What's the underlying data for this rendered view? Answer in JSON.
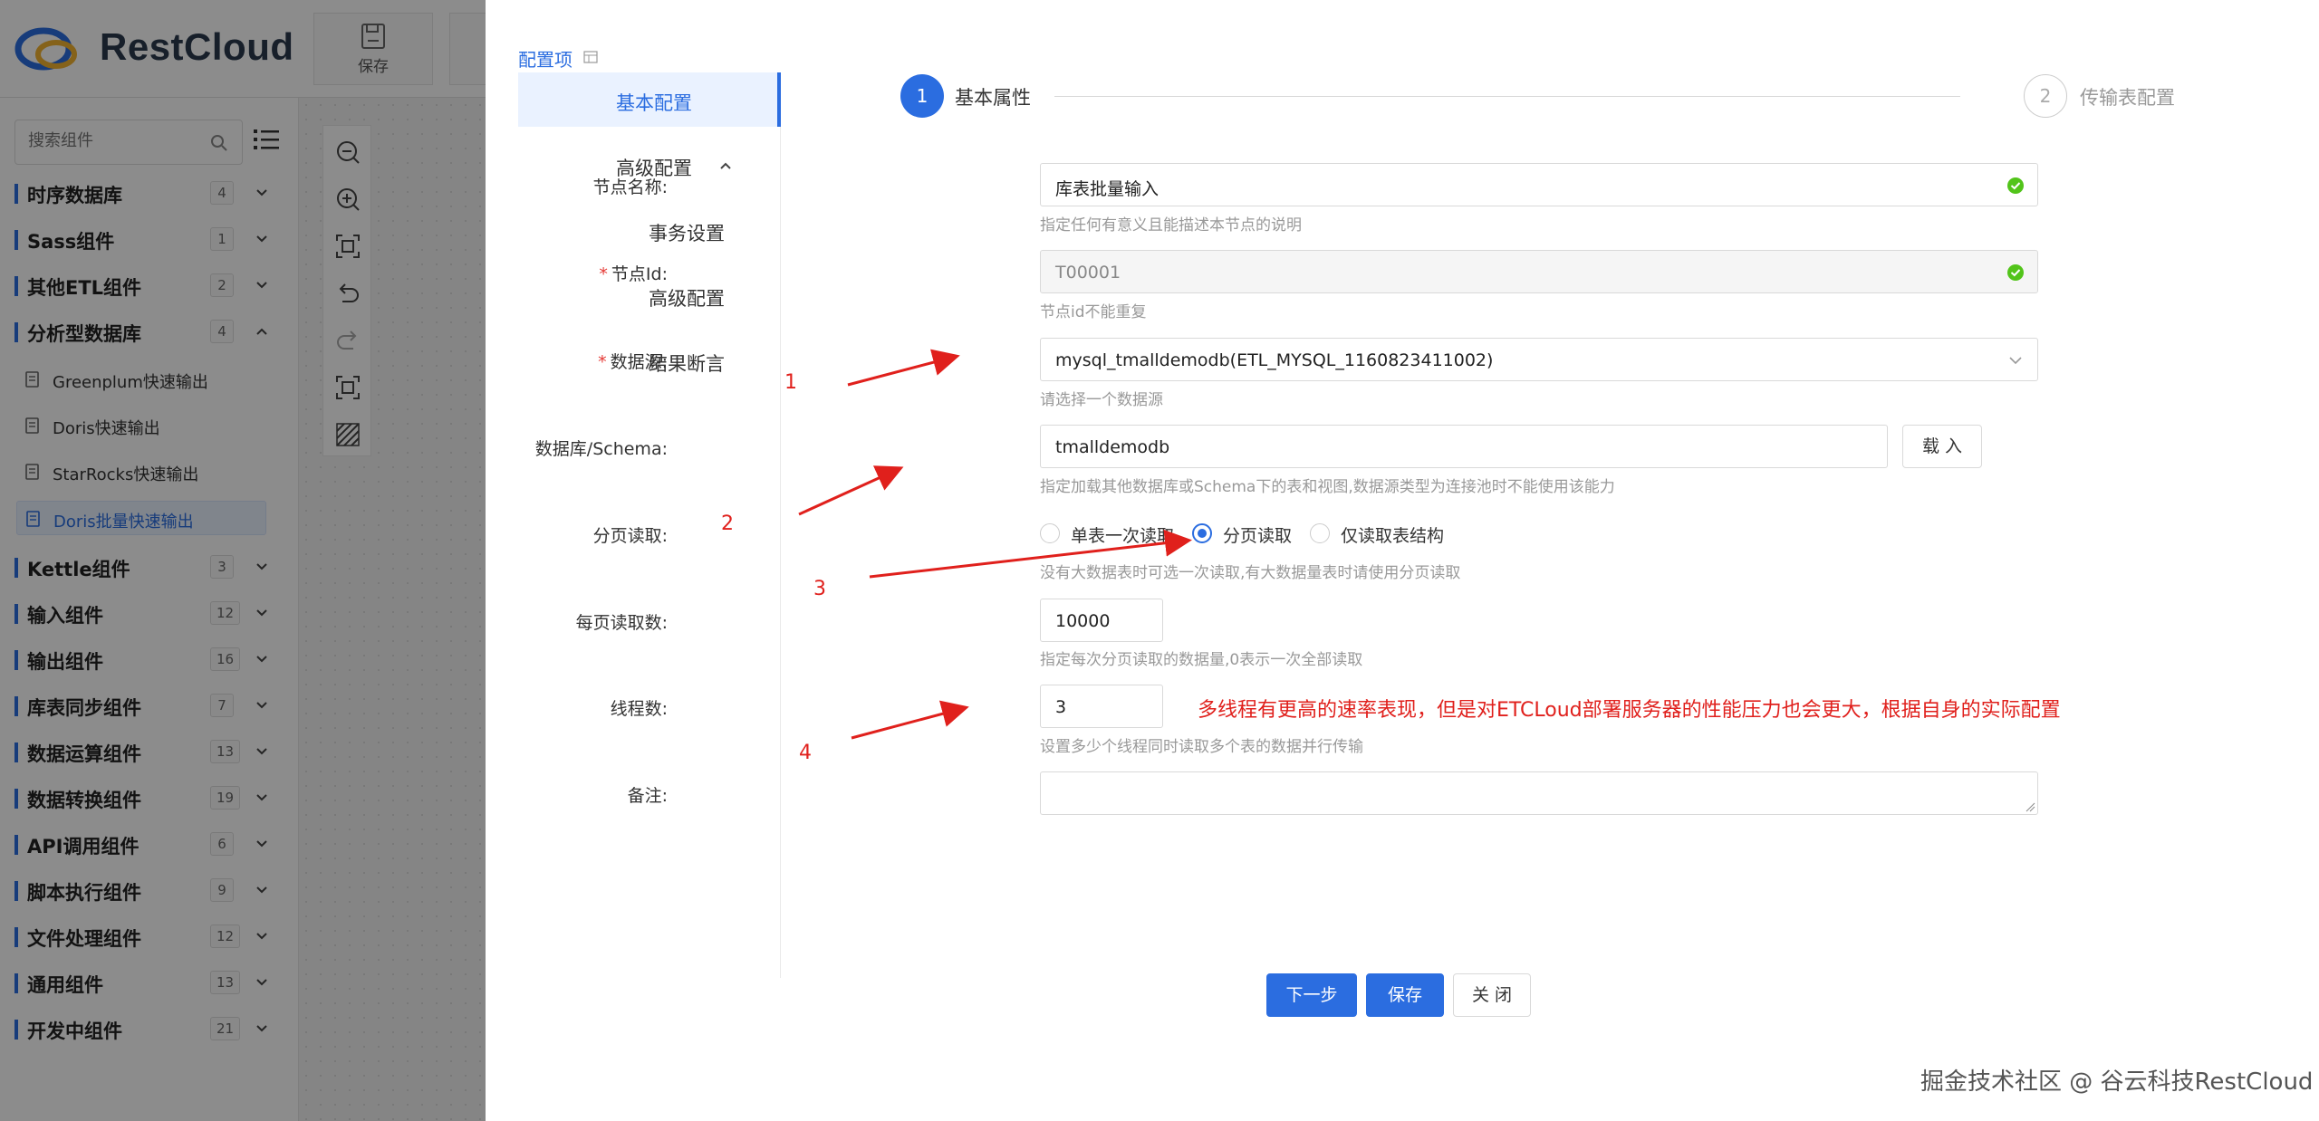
{
  "app": {
    "logo_text": "RestCloud",
    "toolbar": {
      "save_label": "保存"
    },
    "search": {
      "placeholder": "搜索组件"
    },
    "categories": [
      {
        "name": "时序数据库",
        "count": "4",
        "expanded": false
      },
      {
        "name": "Sass组件",
        "count": "1",
        "expanded": false
      },
      {
        "name": "其他ETL组件",
        "count": "2",
        "expanded": false
      },
      {
        "name": "分析型数据库",
        "count": "4",
        "expanded": true
      },
      {
        "name": "Kettle组件",
        "count": "3",
        "expanded": false
      },
      {
        "name": "输入组件",
        "count": "12",
        "expanded": false
      },
      {
        "name": "输出组件",
        "count": "16",
        "expanded": false
      },
      {
        "name": "库表同步组件",
        "count": "7",
        "expanded": false
      },
      {
        "name": "数据运算组件",
        "count": "13",
        "expanded": false
      },
      {
        "name": "数据转换组件",
        "count": "19",
        "expanded": false
      },
      {
        "name": "API调用组件",
        "count": "6",
        "expanded": false
      },
      {
        "name": "脚本执行组件",
        "count": "9",
        "expanded": false
      },
      {
        "name": "文件处理组件",
        "count": "12",
        "expanded": false
      },
      {
        "name": "通用组件",
        "count": "13",
        "expanded": false
      },
      {
        "name": "开发中组件",
        "count": "21",
        "expanded": false
      }
    ],
    "sub_items": [
      {
        "name": "Greenplum快速输出",
        "active": false
      },
      {
        "name": "Doris快速输出",
        "active": false
      },
      {
        "name": "StarRocks快速输出",
        "active": false
      },
      {
        "name": "Doris批量快速输出",
        "active": true
      }
    ]
  },
  "drawer": {
    "config_title": "配置项",
    "menu": [
      {
        "label": "基本配置",
        "active": true
      },
      {
        "label": "高级配置",
        "expandable": true
      },
      {
        "label": "事务设置"
      },
      {
        "label": "高级配置"
      },
      {
        "label": "结果断言"
      }
    ],
    "steps": [
      {
        "num": "1",
        "label": "基本属性",
        "active": true
      },
      {
        "num": "2",
        "label": "传输表配置",
        "active": false
      }
    ],
    "form": {
      "node_name": {
        "label": "节点名称:",
        "value": "库表批量输入",
        "hint": "指定任何有意义且能描述本节点的说明"
      },
      "node_id": {
        "label": "节点Id:",
        "required": true,
        "value": "T00001",
        "hint": "节点id不能重复"
      },
      "datasource": {
        "label": "数据源:",
        "required": true,
        "value": "mysql_tmalldemodb(ETL_MYSQL_1160823411002)",
        "hint": "请选择一个数据源"
      },
      "schema": {
        "label": "数据库/Schema:",
        "value": "tmalldemodb",
        "load_button": "载 入",
        "hint": "指定加载其他数据库或Schema下的表和视图,数据源类型为连接池时不能使用该能力"
      },
      "paging": {
        "label": "分页读取:",
        "options": [
          "单表一次读取",
          "分页读取",
          "仅读取表结构"
        ],
        "selected": "分页读取",
        "hint": "没有大数据表时可选一次读取,有大数据量表时请使用分页读取"
      },
      "page_size": {
        "label": "每页读取数:",
        "value": "10000",
        "hint": "指定每次分页读取的数据量,0表示一次全部读取"
      },
      "threads": {
        "label": "线程数:",
        "value": "3",
        "hint": "设置多少个线程同时读取多个表的数据并行传输"
      },
      "remark": {
        "label": "备注:",
        "value": ""
      }
    },
    "buttons": {
      "next": "下一步",
      "save": "保存",
      "close": "关 闭"
    },
    "annotations": {
      "numbers": [
        "1",
        "2",
        "3",
        "4"
      ],
      "note": "多线程有更高的速率表现，但是对ETCLoud部署服务器的性能压力也会更大，根据自身的实际配置"
    },
    "watermark": "掘金技术社区 @ 谷云科技RestCloud"
  },
  "colors": {
    "primary": "#2b6de0",
    "annotation": "#e0201c",
    "success": "#52c41a"
  }
}
